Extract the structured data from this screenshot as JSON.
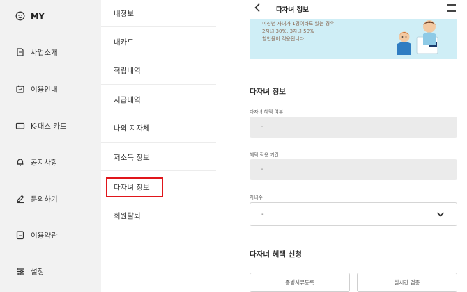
{
  "sidebar": {
    "items": [
      {
        "label": "MY",
        "icon": "smile-icon"
      },
      {
        "label": "사업소개",
        "icon": "document-edit-icon"
      },
      {
        "label": "이용안내",
        "icon": "calendar-icon"
      },
      {
        "label": "K-패스 카드",
        "icon": "card-icon"
      },
      {
        "label": "공지사항",
        "icon": "bell-icon"
      },
      {
        "label": "문의하기",
        "icon": "pencil-icon"
      },
      {
        "label": "이용약관",
        "icon": "document-icon"
      },
      {
        "label": "설정",
        "icon": "settings-sliders-icon"
      }
    ]
  },
  "submenu": {
    "items": [
      {
        "label": "내정보"
      },
      {
        "label": "내카드"
      },
      {
        "label": "적립내역"
      },
      {
        "label": "지급내역"
      },
      {
        "label": "나의 지자체"
      },
      {
        "label": "저소득 정보"
      },
      {
        "label": "다자녀 정보"
      },
      {
        "label": "회원탈퇴"
      }
    ],
    "highlight_color": "#e0161b"
  },
  "detail": {
    "title": "다자녀 정보",
    "banner": {
      "lines": [
        "미성년 자녀가 1명이라도 있는 경우",
        "2자녀 30%, 3자녀 50%",
        "할인율이 적용됩니다!"
      ],
      "background": "#cfeef6"
    },
    "section_title": "다자녀 정보",
    "fields": {
      "benefit_label": "다자녀 혜택 여부",
      "benefit_value": "-",
      "period_label": "혜택 적용 기간",
      "period_value": "-",
      "children_label": "자녀수",
      "children_value": "-"
    },
    "apply_title": "다자녀 혜택 신청",
    "buttons": {
      "doc_upload": "증빙서류등록",
      "realtime_verify": "실시간 검증"
    }
  }
}
